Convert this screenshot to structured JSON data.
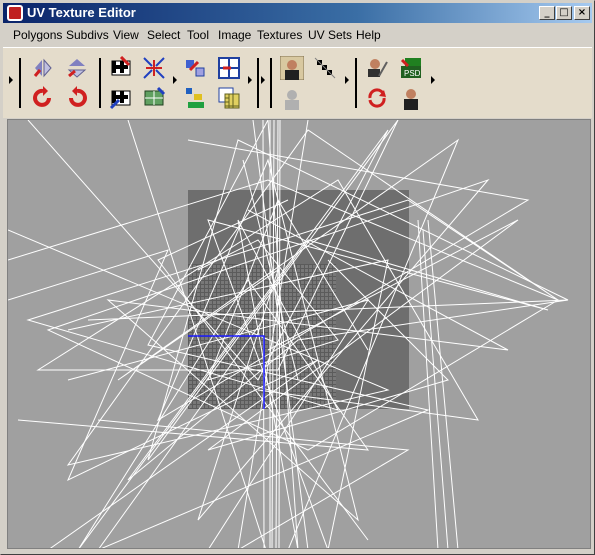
{
  "window": {
    "title": "UV Texture Editor"
  },
  "title_buttons": {
    "minimize": "_",
    "maximize": "□",
    "close": "×"
  },
  "menu": [
    "Polygons",
    "Subdivs",
    "View",
    "Select",
    "Tool",
    "Image",
    "Textures",
    "UV Sets",
    "Help"
  ],
  "toolbar": {
    "icons": [
      "flip-u-icon",
      "flip-v-icon",
      "rotate-ccw-icon",
      "rotate-cw-icon",
      "cut-uv-edges-icon",
      "sew-uv-edges-icon",
      "map-uv-border-icon",
      "relax-uvs-icon",
      "move-sew-icon",
      "grid-uvs-icon",
      "layout-uvs-icon",
      "checker-map-icon",
      "display-image-icon",
      "dim-image-icon",
      "toggle-filter-icon",
      "snapshot-uvs-icon",
      "psd-network-icon",
      "reload-texture-icon",
      "texture-borders-icon"
    ]
  },
  "colors": {
    "canvas_bg": "#a0a0a0",
    "uv_square": "#6e6e6e",
    "wire": "#ffffff",
    "selection": "#1a1aff"
  }
}
